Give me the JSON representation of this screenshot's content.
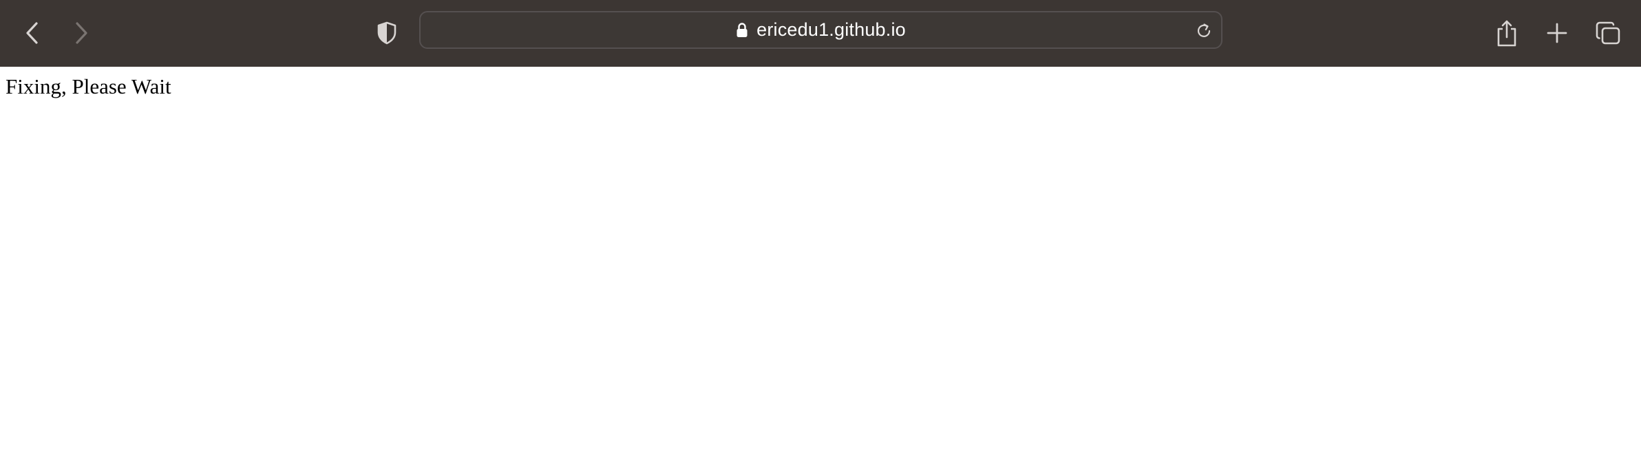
{
  "browser": {
    "address_bar": {
      "url": "ericedu1.github.io"
    },
    "icons": {
      "back": "chevron-left-icon",
      "forward": "chevron-right-icon",
      "privacy": "shield-icon",
      "lock": "lock-icon",
      "reload": "reload-icon",
      "share": "share-icon",
      "new_tab": "plus-icon",
      "tab_overview": "tabs-icon"
    },
    "colors": {
      "toolbar": "#3c3633",
      "address_bar": "#3d3835",
      "icon_active": "#d8d4d2",
      "icon_disabled": "#7a7471"
    }
  },
  "page": {
    "body_text": "Fixing, Please Wait"
  }
}
